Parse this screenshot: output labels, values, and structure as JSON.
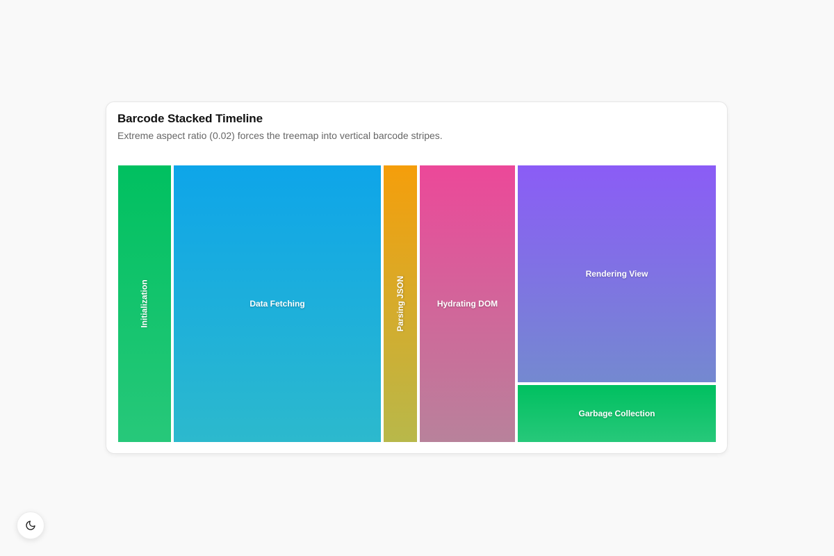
{
  "header": {
    "title": "Barcode Stacked Timeline",
    "subtitle": "Extreme aspect ratio (0.02) forces the treemap into vertical barcode stripes."
  },
  "chart_data": {
    "type": "treemap",
    "layout": "vertical stripes, last stripe split vertically",
    "items": [
      {
        "label": "Initialization",
        "value": 31,
        "color_top": "#00c060",
        "color_bottom": "#27c87a",
        "label_orientation": "vertical"
      },
      {
        "label": "Data Fetching",
        "value": 119,
        "color_top": "#0ea5e9",
        "color_bottom": "#2cb9cd",
        "label_orientation": "horizontal"
      },
      {
        "label": "Parsing JSON",
        "value": 20,
        "color_top": "#f59e0b",
        "color_bottom": "#b8b84a",
        "label_orientation": "vertical"
      },
      {
        "label": "Hydrating DOM",
        "value": 55,
        "color_top": "#ec4899",
        "color_bottom": "#b8829b",
        "label_orientation": "horizontal"
      },
      {
        "label": "Rendering View",
        "value": 90,
        "color_top": "#8b5cf6",
        "color_bottom": "#7489d0",
        "label_orientation": "horizontal"
      },
      {
        "label": "Garbage Collection",
        "value": 24,
        "color_top": "#00c060",
        "color_bottom": "#27c87a",
        "label_orientation": "horizontal"
      }
    ]
  },
  "theme_toggle": {
    "icon": "moon-icon"
  }
}
